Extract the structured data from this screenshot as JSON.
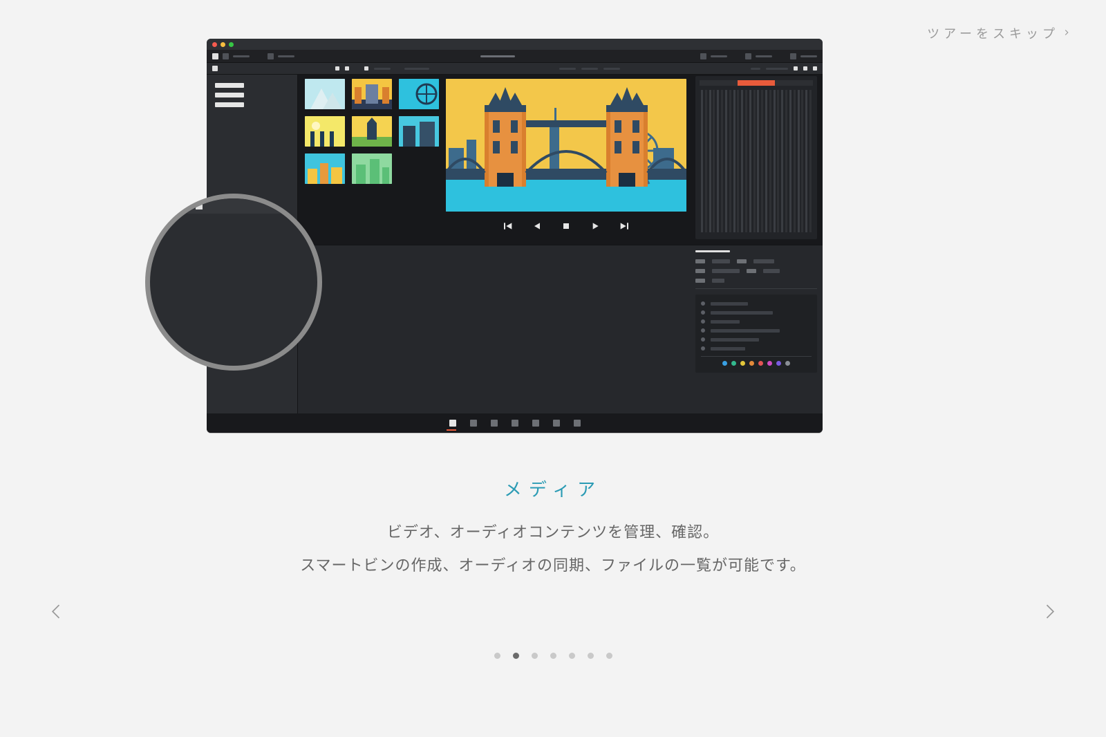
{
  "skip_tour": "ツアーをスキップ",
  "tour": {
    "title": "メディア",
    "line1": "ビデオ、オーディオコンテンツを管理、確認。",
    "line2": "スマートビンの作成、オーディオの同期、ファイルの一覧が可能です。"
  },
  "dots": {
    "count": 7,
    "active_index": 1
  },
  "page_tabs": {
    "count": 7,
    "active_index": 0
  },
  "transport_icons": [
    "jump-start-icon",
    "step-back-icon",
    "stop-icon",
    "play-icon",
    "jump-end-icon"
  ],
  "clip_colors": [
    "#39a0e3",
    "#33b98e",
    "#e3c63a",
    "#e38a3a",
    "#e35454",
    "#d04cc3",
    "#7a5ae0",
    "#8a8f96"
  ]
}
